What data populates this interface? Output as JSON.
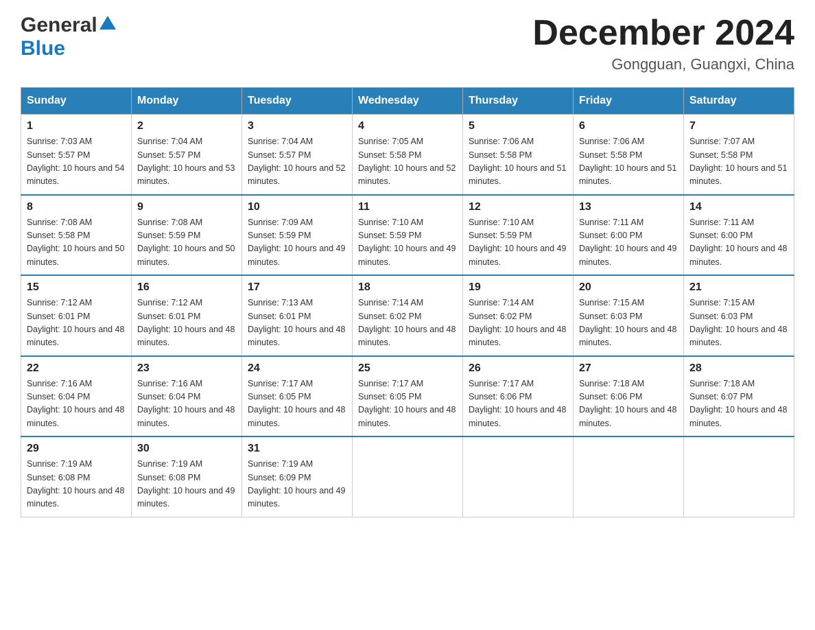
{
  "logo": {
    "general": "General",
    "blue": "Blue"
  },
  "header": {
    "month_year": "December 2024",
    "location": "Gongguan, Guangxi, China"
  },
  "days_of_week": [
    "Sunday",
    "Monday",
    "Tuesday",
    "Wednesday",
    "Thursday",
    "Friday",
    "Saturday"
  ],
  "weeks": [
    [
      {
        "day": "1",
        "sunrise": "7:03 AM",
        "sunset": "5:57 PM",
        "daylight": "10 hours and 54 minutes."
      },
      {
        "day": "2",
        "sunrise": "7:04 AM",
        "sunset": "5:57 PM",
        "daylight": "10 hours and 53 minutes."
      },
      {
        "day": "3",
        "sunrise": "7:04 AM",
        "sunset": "5:57 PM",
        "daylight": "10 hours and 52 minutes."
      },
      {
        "day": "4",
        "sunrise": "7:05 AM",
        "sunset": "5:58 PM",
        "daylight": "10 hours and 52 minutes."
      },
      {
        "day": "5",
        "sunrise": "7:06 AM",
        "sunset": "5:58 PM",
        "daylight": "10 hours and 51 minutes."
      },
      {
        "day": "6",
        "sunrise": "7:06 AM",
        "sunset": "5:58 PM",
        "daylight": "10 hours and 51 minutes."
      },
      {
        "day": "7",
        "sunrise": "7:07 AM",
        "sunset": "5:58 PM",
        "daylight": "10 hours and 51 minutes."
      }
    ],
    [
      {
        "day": "8",
        "sunrise": "7:08 AM",
        "sunset": "5:58 PM",
        "daylight": "10 hours and 50 minutes."
      },
      {
        "day": "9",
        "sunrise": "7:08 AM",
        "sunset": "5:59 PM",
        "daylight": "10 hours and 50 minutes."
      },
      {
        "day": "10",
        "sunrise": "7:09 AM",
        "sunset": "5:59 PM",
        "daylight": "10 hours and 49 minutes."
      },
      {
        "day": "11",
        "sunrise": "7:10 AM",
        "sunset": "5:59 PM",
        "daylight": "10 hours and 49 minutes."
      },
      {
        "day": "12",
        "sunrise": "7:10 AM",
        "sunset": "5:59 PM",
        "daylight": "10 hours and 49 minutes."
      },
      {
        "day": "13",
        "sunrise": "7:11 AM",
        "sunset": "6:00 PM",
        "daylight": "10 hours and 49 minutes."
      },
      {
        "day": "14",
        "sunrise": "7:11 AM",
        "sunset": "6:00 PM",
        "daylight": "10 hours and 48 minutes."
      }
    ],
    [
      {
        "day": "15",
        "sunrise": "7:12 AM",
        "sunset": "6:01 PM",
        "daylight": "10 hours and 48 minutes."
      },
      {
        "day": "16",
        "sunrise": "7:12 AM",
        "sunset": "6:01 PM",
        "daylight": "10 hours and 48 minutes."
      },
      {
        "day": "17",
        "sunrise": "7:13 AM",
        "sunset": "6:01 PM",
        "daylight": "10 hours and 48 minutes."
      },
      {
        "day": "18",
        "sunrise": "7:14 AM",
        "sunset": "6:02 PM",
        "daylight": "10 hours and 48 minutes."
      },
      {
        "day": "19",
        "sunrise": "7:14 AM",
        "sunset": "6:02 PM",
        "daylight": "10 hours and 48 minutes."
      },
      {
        "day": "20",
        "sunrise": "7:15 AM",
        "sunset": "6:03 PM",
        "daylight": "10 hours and 48 minutes."
      },
      {
        "day": "21",
        "sunrise": "7:15 AM",
        "sunset": "6:03 PM",
        "daylight": "10 hours and 48 minutes."
      }
    ],
    [
      {
        "day": "22",
        "sunrise": "7:16 AM",
        "sunset": "6:04 PM",
        "daylight": "10 hours and 48 minutes."
      },
      {
        "day": "23",
        "sunrise": "7:16 AM",
        "sunset": "6:04 PM",
        "daylight": "10 hours and 48 minutes."
      },
      {
        "day": "24",
        "sunrise": "7:17 AM",
        "sunset": "6:05 PM",
        "daylight": "10 hours and 48 minutes."
      },
      {
        "day": "25",
        "sunrise": "7:17 AM",
        "sunset": "6:05 PM",
        "daylight": "10 hours and 48 minutes."
      },
      {
        "day": "26",
        "sunrise": "7:17 AM",
        "sunset": "6:06 PM",
        "daylight": "10 hours and 48 minutes."
      },
      {
        "day": "27",
        "sunrise": "7:18 AM",
        "sunset": "6:06 PM",
        "daylight": "10 hours and 48 minutes."
      },
      {
        "day": "28",
        "sunrise": "7:18 AM",
        "sunset": "6:07 PM",
        "daylight": "10 hours and 48 minutes."
      }
    ],
    [
      {
        "day": "29",
        "sunrise": "7:19 AM",
        "sunset": "6:08 PM",
        "daylight": "10 hours and 48 minutes."
      },
      {
        "day": "30",
        "sunrise": "7:19 AM",
        "sunset": "6:08 PM",
        "daylight": "10 hours and 49 minutes."
      },
      {
        "day": "31",
        "sunrise": "7:19 AM",
        "sunset": "6:09 PM",
        "daylight": "10 hours and 49 minutes."
      },
      null,
      null,
      null,
      null
    ]
  ],
  "labels": {
    "sunrise_prefix": "Sunrise: ",
    "sunset_prefix": "Sunset: ",
    "daylight_prefix": "Daylight: "
  }
}
